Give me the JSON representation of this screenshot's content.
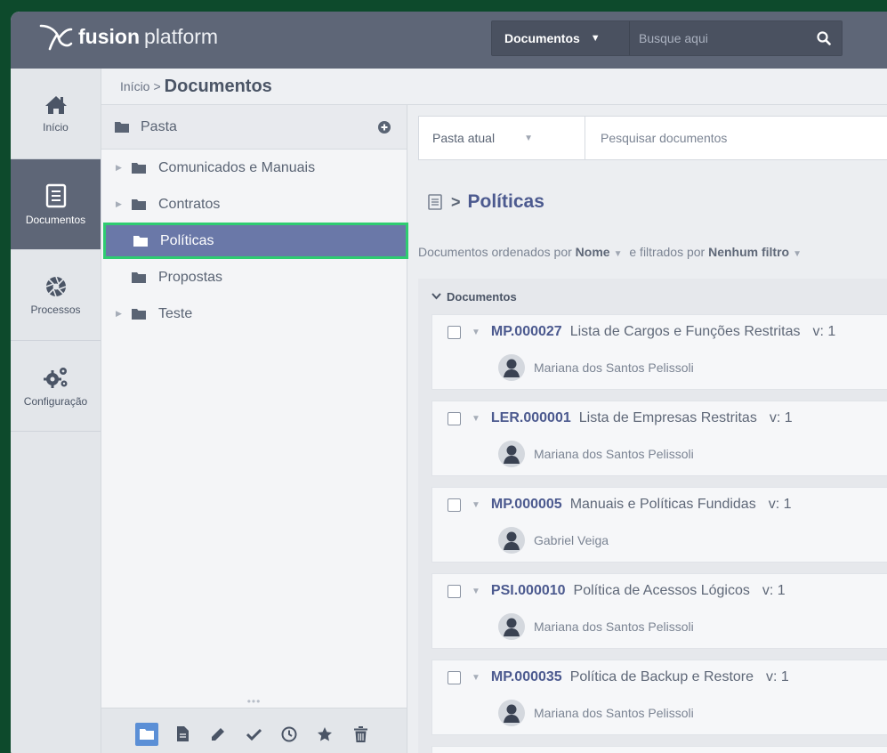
{
  "app": {
    "logo_bold": "fusion",
    "logo_light": "platform",
    "search_scope": "Documentos",
    "search_placeholder": "Busque aqui"
  },
  "nav": {
    "items": [
      {
        "label": "Início",
        "icon": "home-icon"
      },
      {
        "label": "Documentos",
        "icon": "document-icon"
      },
      {
        "label": "Processos",
        "icon": "aperture-icon"
      },
      {
        "label": "Configuração",
        "icon": "gears-icon"
      }
    ],
    "active": "Documentos"
  },
  "breadcrumb": {
    "parent": "Início",
    "separator": ">",
    "current": "Documentos"
  },
  "folders": {
    "header": "Pasta",
    "items": [
      {
        "label": "Comunicados e Manuais",
        "expandable": true
      },
      {
        "label": "Contratos",
        "expandable": true
      },
      {
        "label": "Políticas",
        "expandable": false,
        "selected": true
      },
      {
        "label": "Propostas",
        "expandable": false
      },
      {
        "label": "Teste",
        "expandable": true
      }
    ],
    "toolbar_dots": "•••",
    "toolbar": [
      "folder-icon",
      "file-icon",
      "pencil-icon",
      "check-icon",
      "clock-icon",
      "star-icon",
      "trash-icon"
    ]
  },
  "content": {
    "scope_label": "Pasta atual",
    "search_placeholder": "Pesquisar documentos",
    "title": "Políticas",
    "sort_prefix": "Documentos ordenados por",
    "sort_field": "Nome",
    "filter_prefix": "e filtrados por",
    "filter_value": "Nenhum filtro",
    "section_label": "Documentos",
    "documents": [
      {
        "code": "MP.000027",
        "title": "Lista de Cargos e Funções Restritas",
        "version": "v: 1",
        "author": "Mariana dos Santos Pelissoli"
      },
      {
        "code": "LER.000001",
        "title": "Lista de Empresas Restritas",
        "version": "v: 1",
        "author": "Mariana dos Santos Pelissoli"
      },
      {
        "code": "MP.000005",
        "title": "Manuais e Políticas Fundidas",
        "version": "v: 1",
        "author": "Gabriel Veiga"
      },
      {
        "code": "PSI.000010",
        "title": "Política de Acessos Lógicos",
        "version": "v: 1",
        "author": "Mariana dos Santos Pelissoli"
      },
      {
        "code": "MP.000035",
        "title": "Política de Backup e Restore",
        "version": "v: 1",
        "author": "Mariana dos Santos Pelissoli"
      }
    ]
  },
  "colors": {
    "topbar": "#5e6677",
    "accent": "#4c5a8f",
    "selection": "#6a78a8",
    "highlight_outline": "#2ecc71",
    "background": "#0d4a2c"
  }
}
